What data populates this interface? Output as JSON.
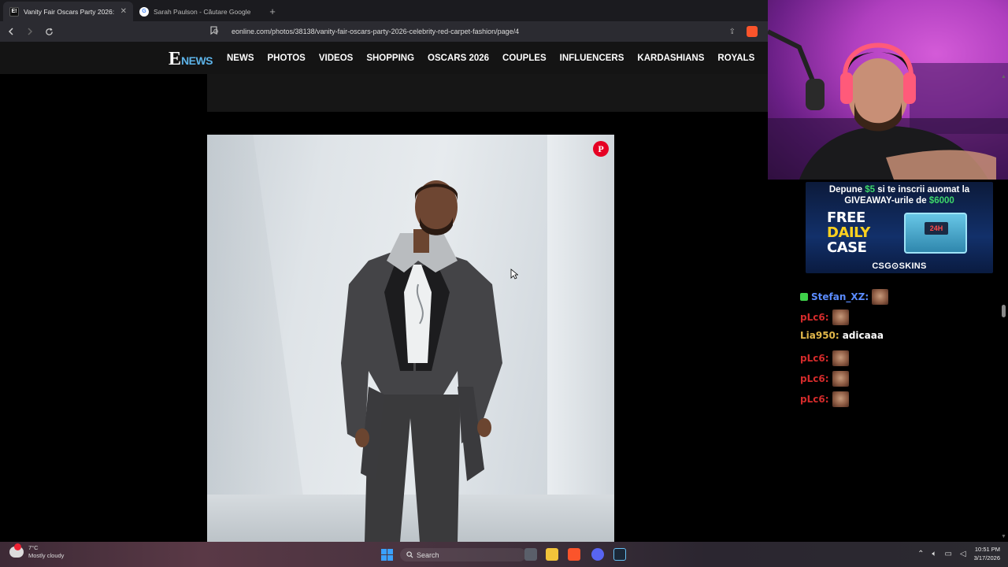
{
  "browser": {
    "tabs": [
      {
        "title": "Vanity Fair Oscars Party 2026: Ce",
        "active": true,
        "favicon": "eonline-favicon"
      },
      {
        "title": "Sarah Paulson - Căutare Google",
        "active": false,
        "favicon": "google-favicon"
      }
    ],
    "close_label": "✕",
    "newtab_label": "+",
    "url": "eonline.com/photos/38138/vanity-fair-oscars-party-2026-celebrity-red-carpet-fashion/page/4"
  },
  "site": {
    "logo_e": "E",
    "logo_news": "NEWS",
    "nav": [
      "NEWS",
      "PHOTOS",
      "VIDEOS",
      "SHOPPING",
      "OSCARS 2026",
      "COUPLES",
      "INFLUENCERS",
      "KARDASHIANS",
      "ROYALS"
    ],
    "pin_label": "P"
  },
  "promo": {
    "line1_prefix": "Depune ",
    "line1_amount": "$5",
    "line1_suffix": " si te inscrii auomat la",
    "line2_prefix": "GIVEAWAY-urile de ",
    "line2_amount": "$6000",
    "free_1": "FREE",
    "free_2": "DAILY",
    "free_3": "CASE",
    "box_tag": "24H",
    "brand": "CSG⊙SKINS"
  },
  "chat": {
    "messages": [
      {
        "user": "Stefan_XZ:",
        "color": "#5b8cff",
        "emote": true,
        "text": "",
        "badge": true
      },
      {
        "user": "pLc6:",
        "color": "#d42b2b",
        "emote": true,
        "text": ""
      },
      {
        "user": "Lia950:",
        "color": "#e3b84a",
        "emote": false,
        "text": "adicaaa"
      },
      {
        "user": "pLc6:",
        "color": "#d42b2b",
        "emote": true,
        "text": ""
      },
      {
        "user": "pLc6:",
        "color": "#d42b2b",
        "emote": true,
        "text": ""
      },
      {
        "user": "pLc6:",
        "color": "#d42b2b",
        "emote": true,
        "text": ""
      }
    ]
  },
  "taskbar": {
    "weather_temp": "7°C",
    "weather_desc": "Mostly cloudy",
    "search_label": "Search",
    "time": "10:51 PM",
    "date": "3/17/2026"
  },
  "colors": {
    "accent_news": "#5db3e8",
    "pinterest": "#e60023",
    "promo_green": "#3ed86b",
    "promo_yellow": "#ffd21f"
  }
}
